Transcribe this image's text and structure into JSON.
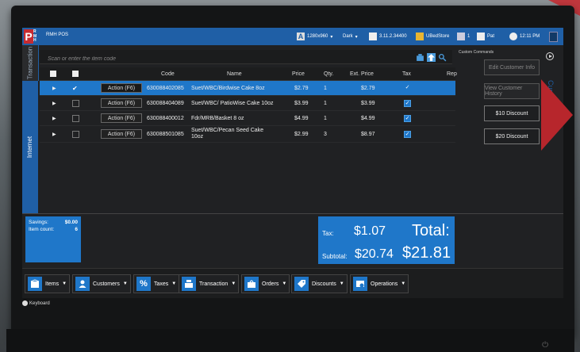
{
  "app": {
    "logo_letters": [
      "R",
      "M",
      "H"
    ],
    "title": "RMH POS"
  },
  "topbar": {
    "resolution": "1280x960",
    "theme": "Dark",
    "version": "3.11.2.34400",
    "store": "UBedStore",
    "register": "1",
    "user": "Pat",
    "time": "12:11 PM"
  },
  "side_tabs": {
    "transaction": "Transaction",
    "internet": "Internet"
  },
  "search": {
    "placeholder": "Scan or enter the item code"
  },
  "table": {
    "headers": {
      "code": "Code",
      "name": "Name",
      "price": "Price",
      "qty": "Qty.",
      "ext_price": "Ext. Price",
      "tax": "Tax",
      "rep": "Rep"
    },
    "rows": [
      {
        "action": "Action (F6)",
        "code": "630088402085",
        "name": "Suet/WBC/Birdwise Cake 8oz",
        "price": "$2.79",
        "qty": "1",
        "ext_price": "$2.79",
        "selected": true
      },
      {
        "action": "Action (F6)",
        "code": "630088404089",
        "name": "Suet/WBC/ PatioWise Cake 10oz",
        "price": "$3.99",
        "qty": "1",
        "ext_price": "$3.99",
        "selected": false
      },
      {
        "action": "Action (F6)",
        "code": "630088400012",
        "name": "Fdr/MRB/Basket 8 oz",
        "price": "$4.99",
        "qty": "1",
        "ext_price": "$4.99",
        "selected": false
      },
      {
        "action": "Action (F6)",
        "code": "630088501085",
        "name": "Suet/WBC/Pecan Seed Cake 10oz",
        "price": "$2.99",
        "qty": "3",
        "ext_price": "$8.97",
        "selected": false
      }
    ]
  },
  "commands": {
    "title": "Custom Commands",
    "sidebar_label": "Custom Co",
    "buttons": [
      {
        "label": "Edit Customer Info",
        "enabled": false
      },
      {
        "label": "View Customer History",
        "enabled": false
      },
      {
        "label": "$10 Discount",
        "enabled": true
      },
      {
        "label": "$20 Discount",
        "enabled": true
      }
    ]
  },
  "summary": {
    "savings_label": "Savings:",
    "savings_value": "$0.00",
    "count_label": "Item count:",
    "count_value": "6",
    "tax_label": "Tax:",
    "tax_value": "$1.07",
    "subtotal_label": "Subtotal:",
    "subtotal_value": "$20.74",
    "total_label": "Total:",
    "total_value": "$21.81"
  },
  "toolbar": [
    {
      "label": "Items",
      "icon": "box-icon"
    },
    {
      "label": "Customers",
      "icon": "person-icon"
    },
    {
      "label": "Taxes",
      "icon": "percent-icon"
    },
    {
      "label": "Transaction",
      "icon": "register-icon"
    },
    {
      "label": "Orders",
      "icon": "cart-icon"
    },
    {
      "label": "Discounts",
      "icon": "tag-icon"
    },
    {
      "label": "Operations",
      "icon": "operations-icon"
    }
  ],
  "keyboard": {
    "label": "Keyboard"
  },
  "colors": {
    "accent": "#1f77c9",
    "topbar": "#1f5fa6",
    "brand_red": "#c62b31"
  }
}
